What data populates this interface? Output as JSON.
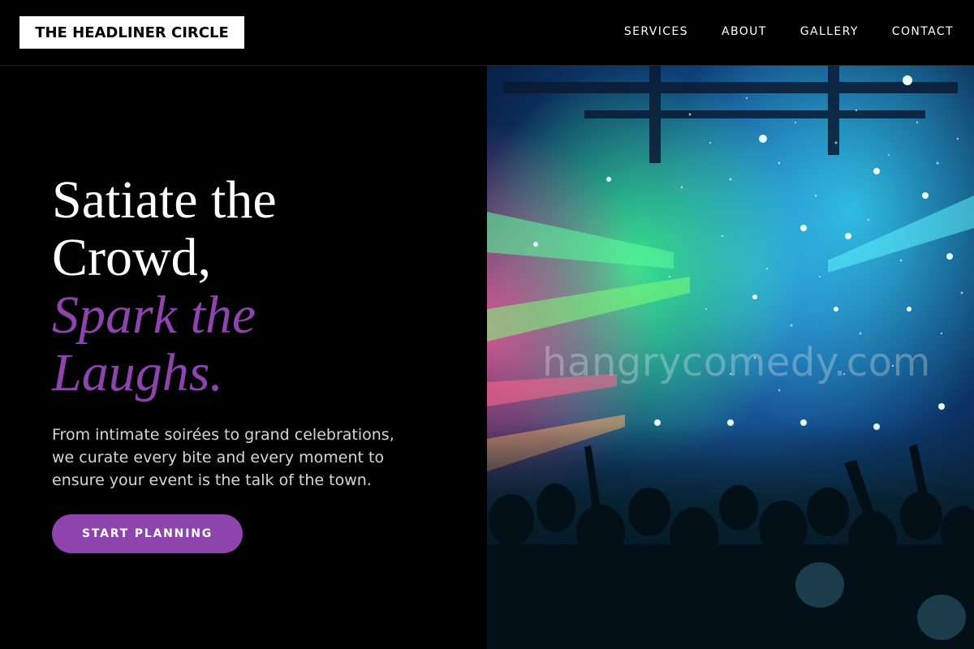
{
  "brand": {
    "name": "THE HEADLINER CIRCLE"
  },
  "nav": {
    "items": [
      "SERVICES",
      "ABOUT",
      "GALLERY",
      "CONTACT"
    ]
  },
  "hero": {
    "headline_line1": "Satiate the",
    "headline_line2": "Crowd,",
    "accent_line1": "Spark the",
    "accent_line2": "Laughs.",
    "subtext_lines": [
      "From intimate soirées to grand celebrations,",
      "we curate every bite and every moment to",
      "ensure your event is the talk of the town."
    ],
    "cta_label": "START PLANNING"
  },
  "image": {
    "watermark": "hangrycomedy.com",
    "subject": "concert-crowd-photo"
  },
  "colors": {
    "background": "#000000",
    "accent": "#8e44ad",
    "logo_bg": "#ffffff"
  }
}
